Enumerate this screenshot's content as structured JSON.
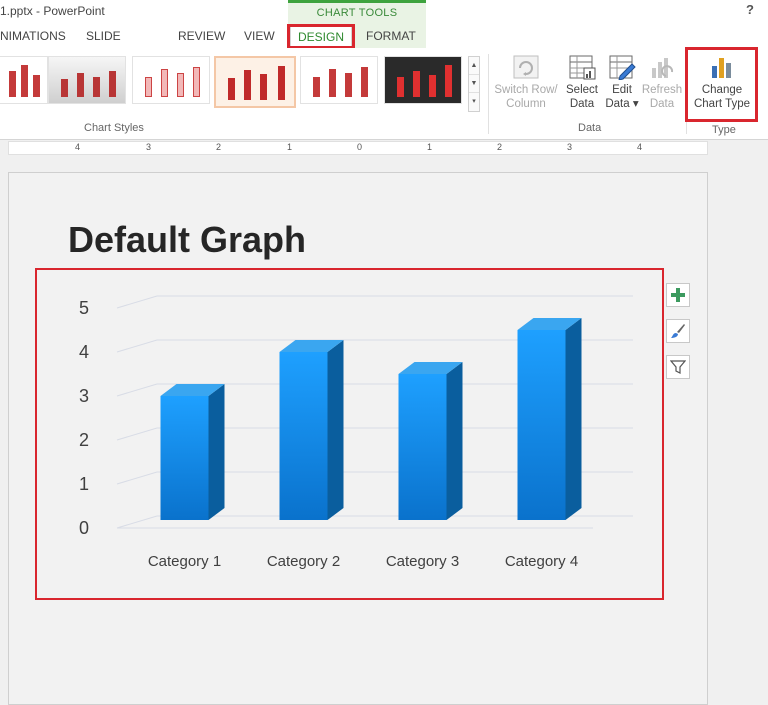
{
  "window": {
    "title": "1.pptx - PowerPoint",
    "help": "?",
    "context_header": "CHART TOOLS"
  },
  "tabs": [
    {
      "label": "NIMATIONS"
    },
    {
      "label": "SLIDE SHOW"
    },
    {
      "label": "REVIEW"
    },
    {
      "label": "VIEW"
    },
    {
      "label": "DESIGN",
      "active": true
    },
    {
      "label": "FORMAT"
    }
  ],
  "ribbon": {
    "chart_styles_label": "Chart Styles",
    "data_group_label": "Data",
    "type_group_label": "Type",
    "buttons": {
      "switch_row_column": {
        "line1": "Switch Row/",
        "line2": "Column",
        "enabled": false
      },
      "select_data": {
        "line1": "Select",
        "line2": "Data",
        "enabled": true
      },
      "edit_data": {
        "line1": "Edit",
        "line2": "Data ▾",
        "enabled": true
      },
      "refresh_data": {
        "line1": "Refresh",
        "line2": "Data",
        "enabled": false
      },
      "change_chart_type": {
        "line1": "Change",
        "line2": "Chart Type",
        "enabled": true
      }
    }
  },
  "ruler": {
    "labels": [
      "4",
      "3",
      "2",
      "1",
      "0",
      "1",
      "2",
      "3",
      "4"
    ]
  },
  "slide": {
    "title": "Default Graph"
  },
  "chart_data": {
    "type": "bar",
    "variant": "3d-column",
    "categories": [
      "Category 1",
      "Category 2",
      "Category 3",
      "Category 4"
    ],
    "series": [
      {
        "values": [
          3,
          4,
          3.5,
          4.5
        ]
      }
    ],
    "ylim": [
      0,
      5
    ],
    "yticks": [
      0,
      1,
      2,
      3,
      4,
      5
    ],
    "grid": true,
    "legend": "none",
    "colors": {
      "bar_front": "#1a8ee8",
      "bar_side": "#0a5e9e",
      "bar_top": "#3aa6f0",
      "grid": "#d8dce6"
    }
  },
  "colors": {
    "highlight": "#d9262e",
    "context_green": "#3ea33e"
  }
}
